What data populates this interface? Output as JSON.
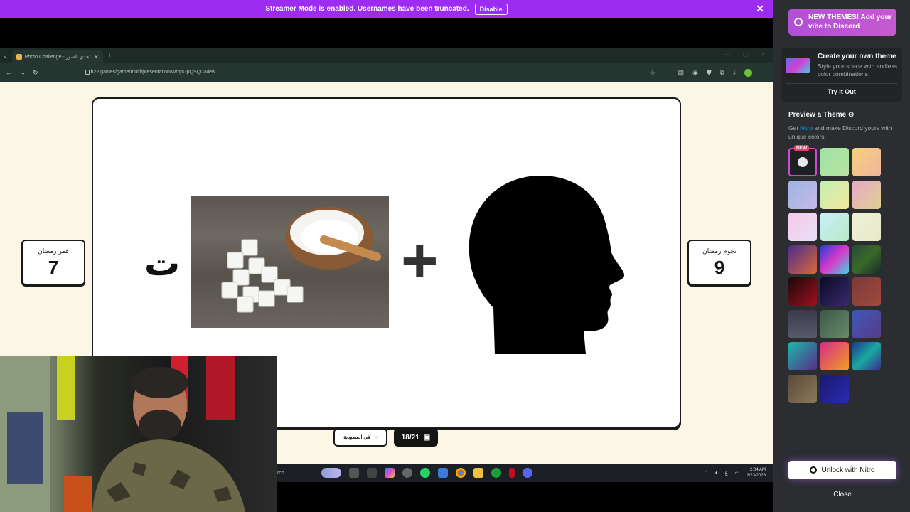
{
  "banner": {
    "message": "Streamer Mode is enabled. Usernames have been truncated.",
    "disable_label": "Disable",
    "close_glyph": "✕"
  },
  "browser": {
    "tab_title": "Photo Challenge - تحدي الصور",
    "url": "b22.games/game/multi/presentation/WmpGpQSQC/view"
  },
  "game": {
    "letter": "ت",
    "left_team": {
      "name": "قمر رمضان",
      "score": "7"
    },
    "right_team": {
      "name": "نجوم رمضان",
      "score": "9"
    },
    "country_label": "في السعودية",
    "progress": "18/21"
  },
  "taskbar": {
    "search_text": "rch",
    "time": "2:04 AM",
    "date": "2/23/2026"
  },
  "sidebar": {
    "promo": "NEW THEMES! Add your vibe to Discord",
    "create_title": "Create your own theme",
    "create_desc": "Style your space with endless color combinations.",
    "try_label": "Try It Out",
    "preview_title": "Preview a Theme",
    "preview_desc_prefix": "Get ",
    "preview_desc_link": "Nitro",
    "preview_desc_suffix": " and make Discord yours with unique colors.",
    "new_badge": "NEW",
    "unlock_label": "Unlock with Nitro",
    "close_label": "Close",
    "theme_colors": [
      "#1e1f22",
      "linear-gradient(135deg,#9fe0a6,#b8e6a0)",
      "linear-gradient(135deg,#f6d27a,#f0b3a0)",
      "linear-gradient(135deg,#9bb6e0,#c8b8e8)",
      "linear-gradient(135deg,#c0f0b0,#f6e7a0)",
      "linear-gradient(135deg,#e8a8c8,#e0d090)",
      "linear-gradient(135deg,#f8c8e8,#e8e0f8)",
      "linear-gradient(135deg,#c8f0f8,#b8e8c8)",
      "linear-gradient(135deg,#f0f0d8,#e8e8c8)",
      "linear-gradient(135deg,#4a2c8a,#d86a3a)",
      "linear-gradient(135deg,#2a3ad8,#d83ac8,#3ad8e0)",
      "linear-gradient(135deg,#2a4a3a,#3a6a2a,#1a2a2a)",
      "linear-gradient(135deg,#1a0a0a,#a01020)",
      "linear-gradient(135deg,#0a0a2a,#3a2a6a)",
      "linear-gradient(135deg,#7a3a3a,#a04a3a)",
      "linear-gradient(180deg,#3a3a4a,#5a5a6a)",
      "linear-gradient(135deg,#3a5a4a,#6a8a6a)",
      "linear-gradient(135deg,#3a5ab8,#5a3a8a)",
      "linear-gradient(135deg,#1ab8a8,#5a2a8a)",
      "linear-gradient(135deg,#d82a8a,#f0a020)",
      "linear-gradient(135deg,#1a3a8a,#1aa8a0,#3a2a8a)",
      "linear-gradient(135deg,#5a4a3a,#8a7a5a)",
      "linear-gradient(135deg,#1a1a6a,#2a2ab8)"
    ]
  }
}
